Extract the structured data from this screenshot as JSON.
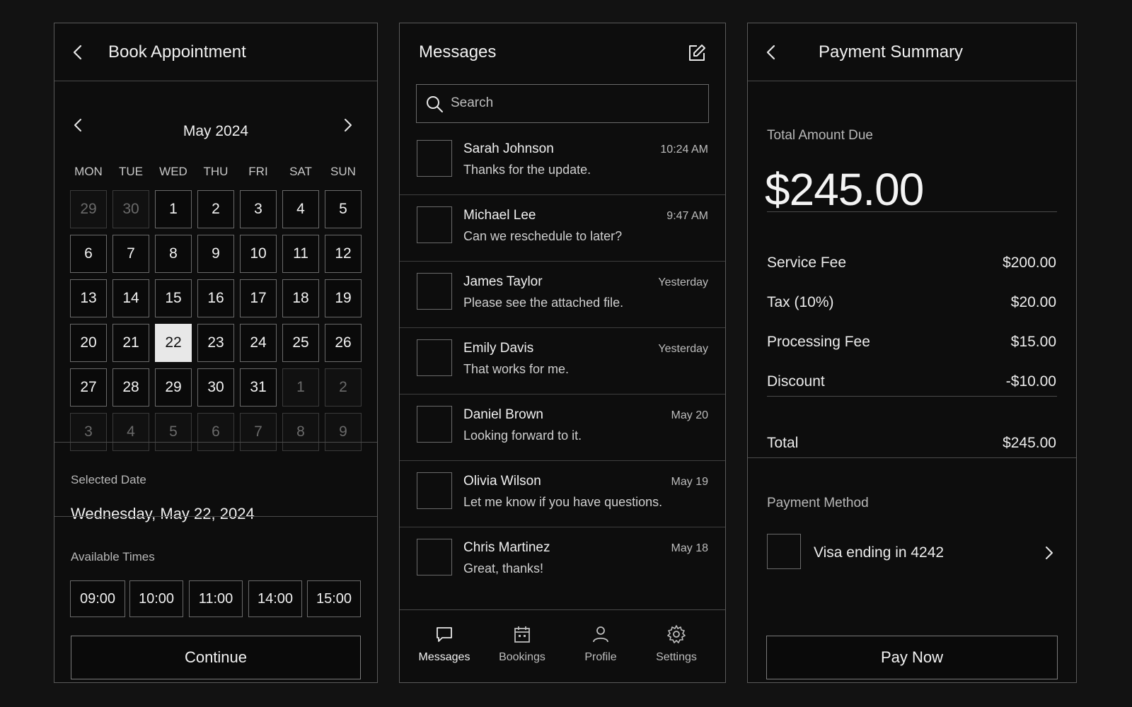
{
  "booking": {
    "title": "Book Appointment",
    "month": "May 2024",
    "weekdays": [
      "MON",
      "TUE",
      "WED",
      "THU",
      "FRI",
      "SAT",
      "SUN"
    ],
    "days": [
      [
        {
          "d": "29",
          "m": 1
        },
        {
          "d": "30",
          "m": 1
        },
        {
          "d": "1"
        },
        {
          "d": "2"
        },
        {
          "d": "3"
        },
        {
          "d": "4"
        },
        {
          "d": "5"
        }
      ],
      [
        {
          "d": "6"
        },
        {
          "d": "7"
        },
        {
          "d": "8"
        },
        {
          "d": "9"
        },
        {
          "d": "10"
        },
        {
          "d": "11"
        },
        {
          "d": "12"
        }
      ],
      [
        {
          "d": "13"
        },
        {
          "d": "14"
        },
        {
          "d": "15"
        },
        {
          "d": "16"
        },
        {
          "d": "17"
        },
        {
          "d": "18"
        },
        {
          "d": "19"
        }
      ],
      [
        {
          "d": "20"
        },
        {
          "d": "21"
        },
        {
          "d": "22",
          "s": 1
        },
        {
          "d": "23"
        },
        {
          "d": "24"
        },
        {
          "d": "25"
        },
        {
          "d": "26"
        }
      ],
      [
        {
          "d": "27"
        },
        {
          "d": "28"
        },
        {
          "d": "29"
        },
        {
          "d": "30"
        },
        {
          "d": "31"
        },
        {
          "d": "1",
          "m": 1
        },
        {
          "d": "2",
          "m": 1
        }
      ],
      [
        {
          "d": "3",
          "m": 1
        },
        {
          "d": "4",
          "m": 1
        },
        {
          "d": "5",
          "m": 1
        },
        {
          "d": "6",
          "m": 1
        },
        {
          "d": "7",
          "m": 1
        },
        {
          "d": "8",
          "m": 1
        },
        {
          "d": "9",
          "m": 1
        }
      ]
    ],
    "selected_date_label": "Selected Date",
    "selected_date": "Wednesday, May 22, 2024",
    "available_times_label": "Available Times",
    "times": [
      "09:00",
      "10:00",
      "11:00",
      "14:00",
      "15:00"
    ],
    "continue_label": "Continue"
  },
  "messages": {
    "title": "Messages",
    "search_placeholder": "Search",
    "items": [
      {
        "name": "Sarah Johnson",
        "preview": "Thanks for the update.",
        "time": "10:24 AM"
      },
      {
        "name": "Michael Lee",
        "preview": "Can we reschedule to later?",
        "time": "9:47 AM"
      },
      {
        "name": "James Taylor",
        "preview": "Please see the attached file.",
        "time": "Yesterday"
      },
      {
        "name": "Emily Davis",
        "preview": "That works for me.",
        "time": "Yesterday"
      },
      {
        "name": "Daniel Brown",
        "preview": "Looking forward to it.",
        "time": "May 20"
      },
      {
        "name": "Olivia Wilson",
        "preview": "Let me know if you have questions.",
        "time": "May 19"
      },
      {
        "name": "Chris Martinez",
        "preview": "Great, thanks!",
        "time": "May 18"
      }
    ],
    "nav": [
      {
        "label": "Messages",
        "icon": "chat-icon",
        "active": true
      },
      {
        "label": "Bookings",
        "icon": "calendar-icon"
      },
      {
        "label": "Profile",
        "icon": "person-icon"
      },
      {
        "label": "Settings",
        "icon": "gear-icon"
      }
    ]
  },
  "payment": {
    "title": "Payment Summary",
    "total_due_label": "Total Amount Due",
    "total_due": "$245.00",
    "rows": [
      {
        "label": "Service Fee",
        "value": "$200.00"
      },
      {
        "label": "Tax (10%)",
        "value": "$20.00"
      },
      {
        "label": "Processing Fee",
        "value": "$15.00"
      },
      {
        "label": "Discount",
        "value": "-$10.00"
      }
    ],
    "total_label": "Total",
    "total_value": "$245.00",
    "method_label": "Payment Method",
    "card_text": "Visa ending in 4242",
    "pay_label": "Pay Now"
  },
  "colors": {
    "background": "#121212",
    "panel": "#0d0d0d",
    "border": "#5a5a5a",
    "selected_day": "#e8e8e8",
    "text": "#f0f0f0"
  }
}
